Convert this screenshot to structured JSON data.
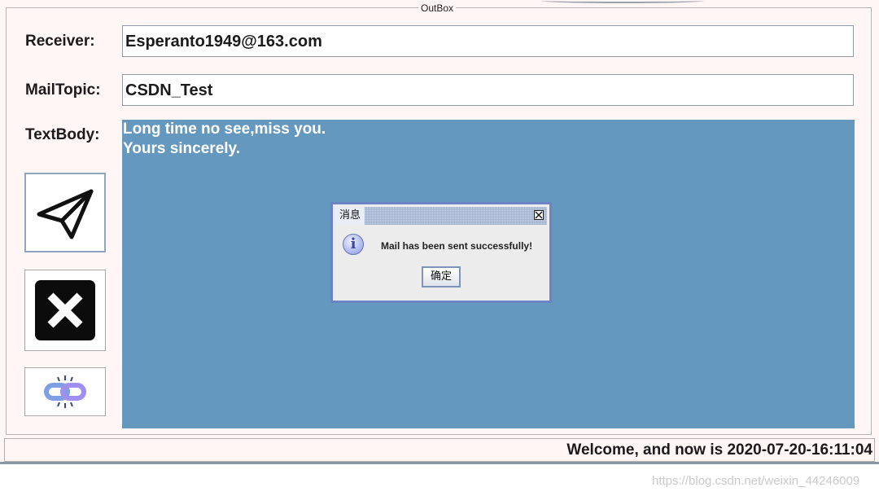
{
  "window": {
    "border_title": "OutBox"
  },
  "form": {
    "receiver_label": "Receiver:",
    "receiver_value": "Esperanto1949@163.com",
    "topic_label": "MailTopic:",
    "topic_value": "CSDN_Test",
    "body_label": "TextBody:",
    "body_lines": [
      "Long time no see,miss you.",
      "Yours sincerely."
    ]
  },
  "buttons": {
    "send_icon": "paper-plane-icon",
    "cancel_icon": "close-x-icon",
    "link_icon": "link-chain-icon"
  },
  "status_bar": {
    "text": "Welcome, and now is 2020-07-20-16:11:04"
  },
  "dialog": {
    "title": "消息",
    "message": "Mail has been sent successfully!",
    "ok_label": "确定",
    "icon": "info-icon",
    "info_glyph": "i"
  },
  "watermark": "https://blog.csdn.net/weixin_44246009",
  "colors": {
    "text_area_bg": "#6598bf",
    "frame_bg": "#fff6f5",
    "dialog_border": "#6c84c4"
  }
}
